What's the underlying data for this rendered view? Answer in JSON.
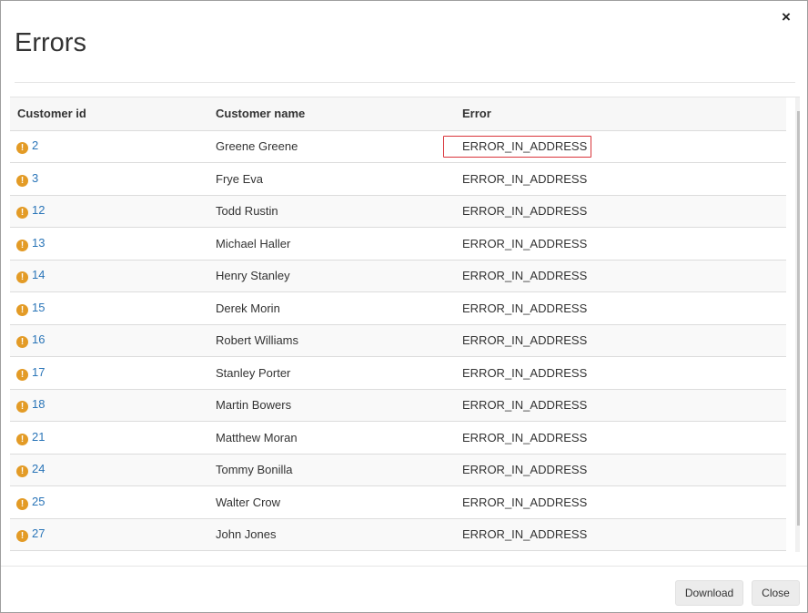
{
  "dialog": {
    "title": "Errors",
    "close_glyph": "×"
  },
  "table": {
    "columns": [
      "Customer id",
      "Customer name",
      "Error"
    ],
    "warning_glyph": "!",
    "rows": [
      {
        "id": "2",
        "name": "Greene Greene",
        "error": "ERROR_IN_ADDRESS"
      },
      {
        "id": "3",
        "name": "Frye Eva",
        "error": "ERROR_IN_ADDRESS"
      },
      {
        "id": "12",
        "name": "Todd Rustin",
        "error": "ERROR_IN_ADDRESS"
      },
      {
        "id": "13",
        "name": "Michael Haller",
        "error": "ERROR_IN_ADDRESS"
      },
      {
        "id": "14",
        "name": "Henry Stanley",
        "error": "ERROR_IN_ADDRESS"
      },
      {
        "id": "15",
        "name": "Derek Morin",
        "error": "ERROR_IN_ADDRESS"
      },
      {
        "id": "16",
        "name": "Robert Williams",
        "error": "ERROR_IN_ADDRESS"
      },
      {
        "id": "17",
        "name": "Stanley Porter",
        "error": "ERROR_IN_ADDRESS"
      },
      {
        "id": "18",
        "name": "Martin Bowers",
        "error": "ERROR_IN_ADDRESS"
      },
      {
        "id": "21",
        "name": "Matthew Moran",
        "error": "ERROR_IN_ADDRESS"
      },
      {
        "id": "24",
        "name": "Tommy Bonilla",
        "error": "ERROR_IN_ADDRESS"
      },
      {
        "id": "25",
        "name": "Walter Crow",
        "error": "ERROR_IN_ADDRESS"
      },
      {
        "id": "27",
        "name": "John Jones",
        "error": "ERROR_IN_ADDRESS"
      }
    ]
  },
  "buttons": {
    "download": "Download",
    "close": "Close"
  },
  "colors": {
    "link": "#2a75b8",
    "warning": "#e39b26",
    "highlight": "#d9343a"
  },
  "icons": {
    "warning": "warning-circle-icon",
    "close": "close-icon",
    "scroll_up": "chevron-up-icon",
    "scroll_down": "chevron-down-icon"
  }
}
